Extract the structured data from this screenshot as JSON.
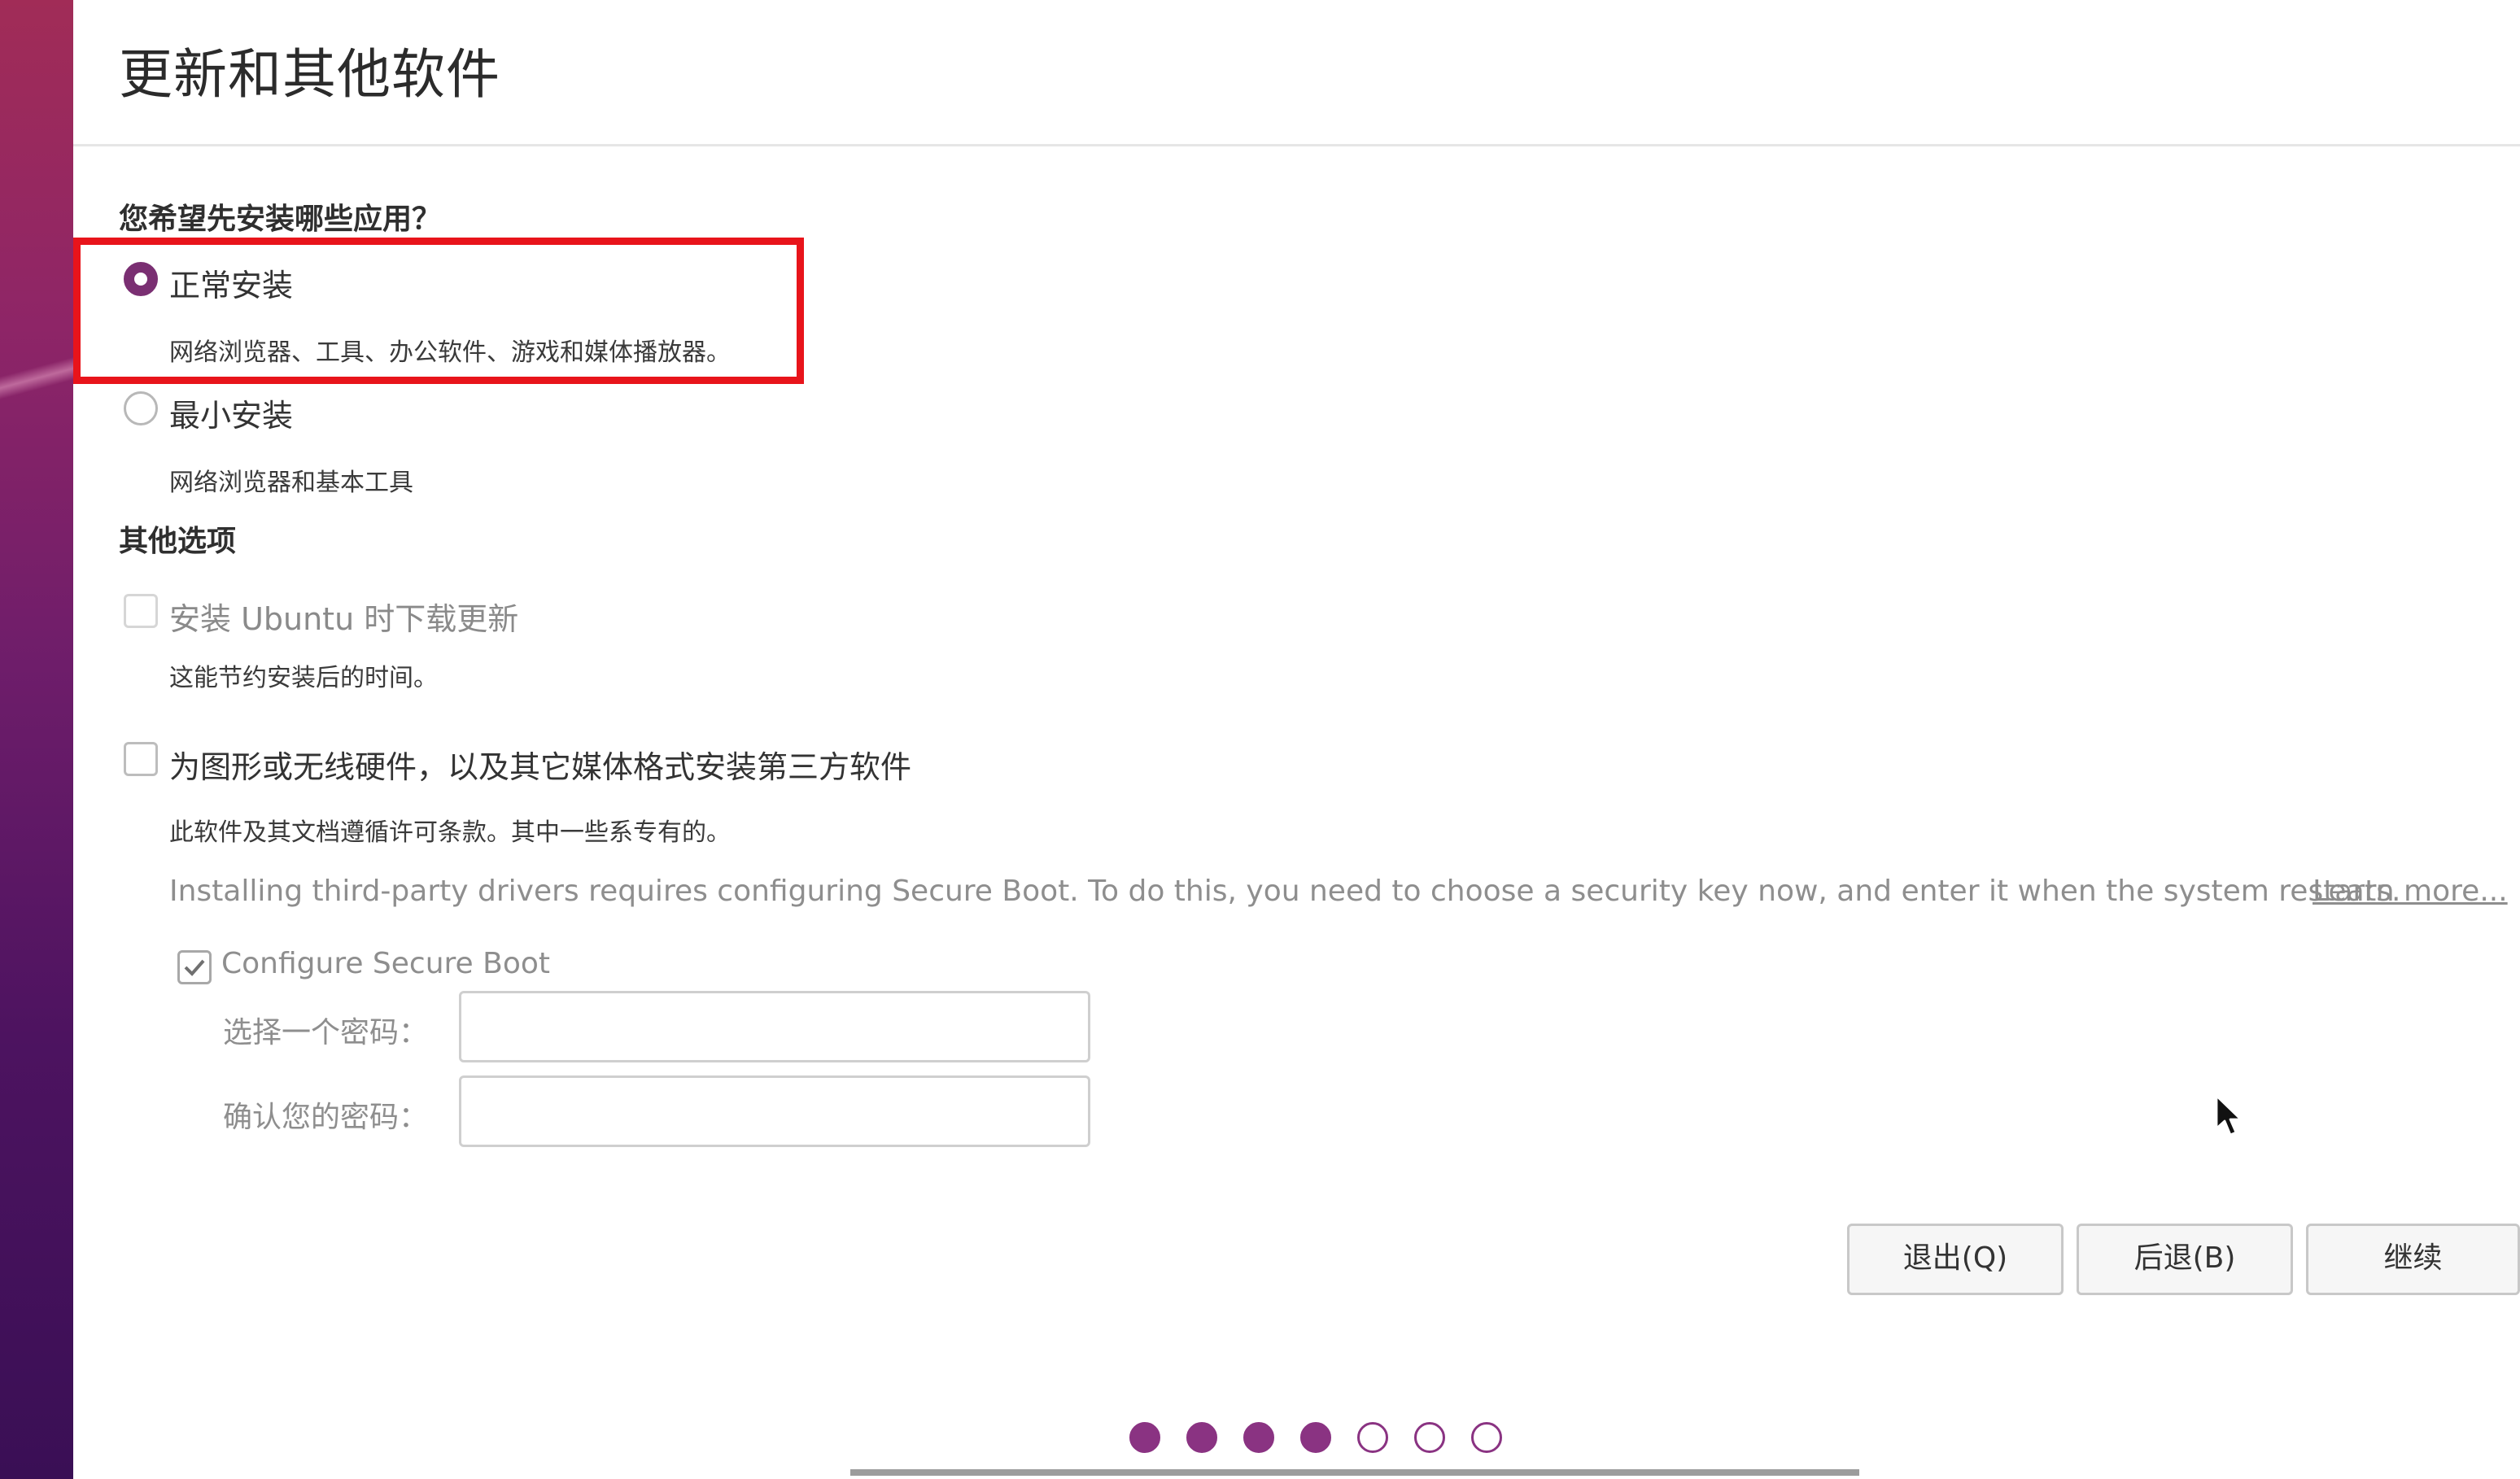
{
  "window": {
    "title": "更新和其他软件"
  },
  "install_type": {
    "heading": "您希望先安装哪些应用？",
    "options": [
      {
        "label": "正常安装",
        "description": "网络浏览器、工具、办公软件、游戏和媒体播放器。",
        "selected": true
      },
      {
        "label": "最小安装",
        "description": "网络浏览器和基本工具",
        "selected": false
      }
    ]
  },
  "other_options": {
    "heading": "其他选项",
    "download_updates": {
      "label": "安装 Ubuntu 时下载更新",
      "description": "这能节约安装后的时间。",
      "checked": false,
      "enabled": false
    },
    "third_party": {
      "label": "为图形或无线硬件，以及其它媒体格式安装第三方软件",
      "description": "此软件及其文档遵循许可条款。其中一些系专有的。",
      "checked": false
    },
    "secure_boot": {
      "note": "Installing third-party drivers requires configuring Secure Boot. To do this, you need to choose a security key now, and enter it when the system restarts.",
      "learn_more": "Learn more...",
      "configure_label": "Configure Secure Boot",
      "configure_checked": true,
      "password_label": "选择一个密码：",
      "confirm_label": "确认您的密码：",
      "password_value": "",
      "confirm_value": ""
    }
  },
  "buttons": {
    "quit": "退出(Q)",
    "back": "后退(B)",
    "continue": "继续"
  },
  "progress": {
    "current_step": 4,
    "total_steps": 7
  },
  "colors": {
    "accent": "#7a2f72",
    "highlight_box": "#e8141b",
    "step_dot": "#8a3382"
  }
}
